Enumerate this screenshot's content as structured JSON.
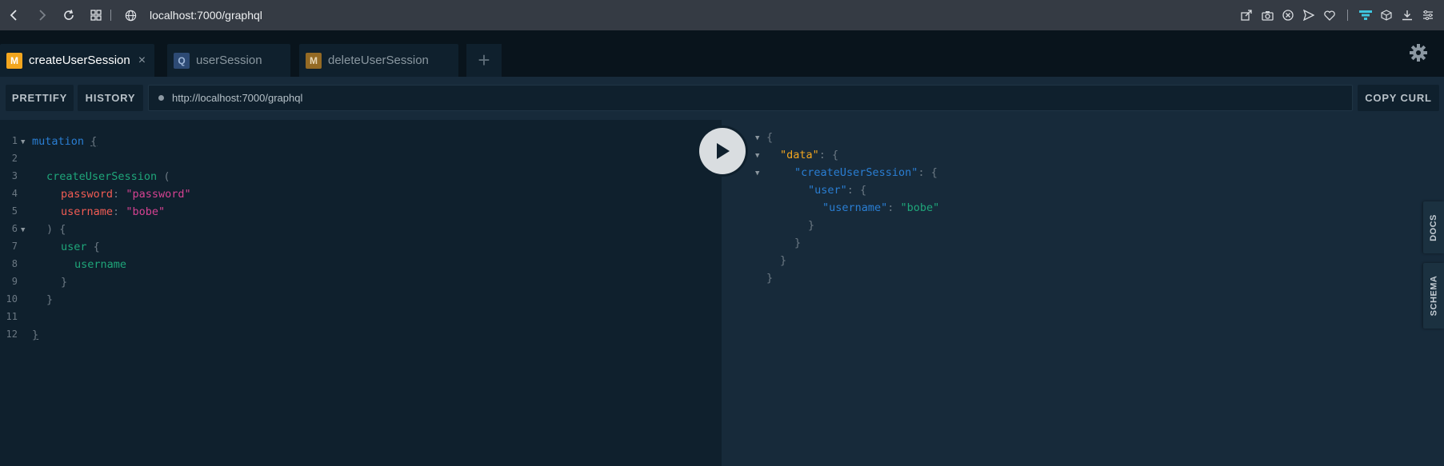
{
  "browser": {
    "url": "localhost:7000/graphql",
    "icons": [
      "back-icon",
      "forward-icon",
      "reload-icon",
      "grid-icon",
      "globe-icon",
      "share-icon",
      "camera-icon",
      "close-circle-icon",
      "send-icon",
      "heart-icon",
      "filter-icon",
      "cube-icon",
      "download-icon",
      "menu-icon"
    ]
  },
  "tabs": [
    {
      "badge": "M",
      "label": "createUserSession",
      "active": true,
      "close": "×"
    },
    {
      "badge": "Q",
      "label": "userSession",
      "active": false
    },
    {
      "badge": "M",
      "label": "deleteUserSession",
      "active": false
    }
  ],
  "add_tab": "+",
  "toolbar": {
    "prettify": "PRETTIFY",
    "history": "HISTORY",
    "endpoint": "http://localhost:7000/graphql",
    "copy_curl": "COPY CURL"
  },
  "query_lines": {
    "n1": "1",
    "n2": "2",
    "n3": "3",
    "n4": "4",
    "n5": "5",
    "n6": "6",
    "n7": "7",
    "n8": "8",
    "n9": "9",
    "n10": "10",
    "n11": "11",
    "n12": "12",
    "mutation": "mutation",
    "open_brace": "{",
    "createUserSession": "createUserSession",
    "open_paren": "(",
    "password_key": "password",
    "password_val": "\"password\"",
    "username_key": "username",
    "username_val": "\"bobe\"",
    "colon": ":",
    "close_paren_brace": ") {",
    "user": "user",
    "username_field": "username",
    "close_brace": "}"
  },
  "result": {
    "open": "{",
    "data_key": "\"data\"",
    "create_key": "\"createUserSession\"",
    "user_key": "\"user\"",
    "username_key": "\"username\"",
    "username_val": "\"bobe\"",
    "colon_brace": ": {",
    "colon": ": ",
    "close": "}"
  },
  "side_tabs": {
    "docs": "DOCS",
    "schema": "SCHEMA"
  },
  "colors": {
    "accent_mutation": "#f2a61f",
    "query_badge": "#2d4a74",
    "keyword": "#2a7ed3",
    "field": "#1fa67a",
    "argument": "#f25c54",
    "string": "#d64292"
  }
}
